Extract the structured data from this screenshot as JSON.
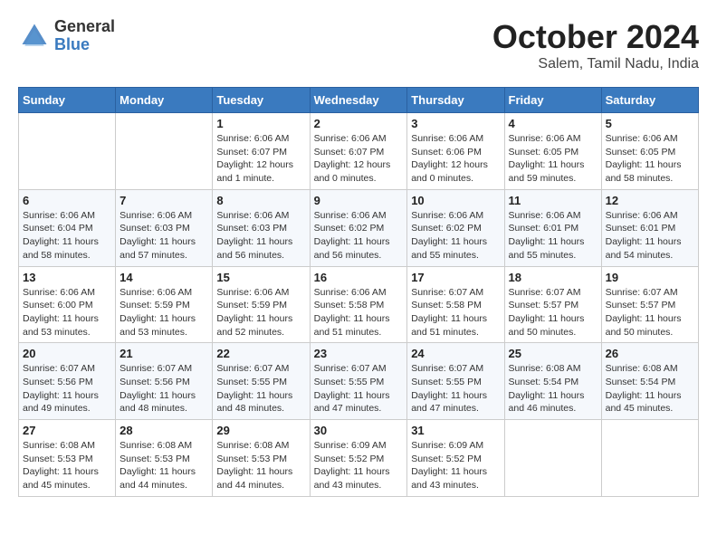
{
  "logo": {
    "general": "General",
    "blue": "Blue"
  },
  "title": "October 2024",
  "location": "Salem, Tamil Nadu, India",
  "days_header": [
    "Sunday",
    "Monday",
    "Tuesday",
    "Wednesday",
    "Thursday",
    "Friday",
    "Saturday"
  ],
  "weeks": [
    [
      {
        "day": "",
        "info": ""
      },
      {
        "day": "",
        "info": ""
      },
      {
        "day": "1",
        "info": "Sunrise: 6:06 AM\nSunset: 6:07 PM\nDaylight: 12 hours\nand 1 minute."
      },
      {
        "day": "2",
        "info": "Sunrise: 6:06 AM\nSunset: 6:07 PM\nDaylight: 12 hours\nand 0 minutes."
      },
      {
        "day": "3",
        "info": "Sunrise: 6:06 AM\nSunset: 6:06 PM\nDaylight: 12 hours\nand 0 minutes."
      },
      {
        "day": "4",
        "info": "Sunrise: 6:06 AM\nSunset: 6:05 PM\nDaylight: 11 hours\nand 59 minutes."
      },
      {
        "day": "5",
        "info": "Sunrise: 6:06 AM\nSunset: 6:05 PM\nDaylight: 11 hours\nand 58 minutes."
      }
    ],
    [
      {
        "day": "6",
        "info": "Sunrise: 6:06 AM\nSunset: 6:04 PM\nDaylight: 11 hours\nand 58 minutes."
      },
      {
        "day": "7",
        "info": "Sunrise: 6:06 AM\nSunset: 6:03 PM\nDaylight: 11 hours\nand 57 minutes."
      },
      {
        "day": "8",
        "info": "Sunrise: 6:06 AM\nSunset: 6:03 PM\nDaylight: 11 hours\nand 56 minutes."
      },
      {
        "day": "9",
        "info": "Sunrise: 6:06 AM\nSunset: 6:02 PM\nDaylight: 11 hours\nand 56 minutes."
      },
      {
        "day": "10",
        "info": "Sunrise: 6:06 AM\nSunset: 6:02 PM\nDaylight: 11 hours\nand 55 minutes."
      },
      {
        "day": "11",
        "info": "Sunrise: 6:06 AM\nSunset: 6:01 PM\nDaylight: 11 hours\nand 55 minutes."
      },
      {
        "day": "12",
        "info": "Sunrise: 6:06 AM\nSunset: 6:01 PM\nDaylight: 11 hours\nand 54 minutes."
      }
    ],
    [
      {
        "day": "13",
        "info": "Sunrise: 6:06 AM\nSunset: 6:00 PM\nDaylight: 11 hours\nand 53 minutes."
      },
      {
        "day": "14",
        "info": "Sunrise: 6:06 AM\nSunset: 5:59 PM\nDaylight: 11 hours\nand 53 minutes."
      },
      {
        "day": "15",
        "info": "Sunrise: 6:06 AM\nSunset: 5:59 PM\nDaylight: 11 hours\nand 52 minutes."
      },
      {
        "day": "16",
        "info": "Sunrise: 6:06 AM\nSunset: 5:58 PM\nDaylight: 11 hours\nand 51 minutes."
      },
      {
        "day": "17",
        "info": "Sunrise: 6:07 AM\nSunset: 5:58 PM\nDaylight: 11 hours\nand 51 minutes."
      },
      {
        "day": "18",
        "info": "Sunrise: 6:07 AM\nSunset: 5:57 PM\nDaylight: 11 hours\nand 50 minutes."
      },
      {
        "day": "19",
        "info": "Sunrise: 6:07 AM\nSunset: 5:57 PM\nDaylight: 11 hours\nand 50 minutes."
      }
    ],
    [
      {
        "day": "20",
        "info": "Sunrise: 6:07 AM\nSunset: 5:56 PM\nDaylight: 11 hours\nand 49 minutes."
      },
      {
        "day": "21",
        "info": "Sunrise: 6:07 AM\nSunset: 5:56 PM\nDaylight: 11 hours\nand 48 minutes."
      },
      {
        "day": "22",
        "info": "Sunrise: 6:07 AM\nSunset: 5:55 PM\nDaylight: 11 hours\nand 48 minutes."
      },
      {
        "day": "23",
        "info": "Sunrise: 6:07 AM\nSunset: 5:55 PM\nDaylight: 11 hours\nand 47 minutes."
      },
      {
        "day": "24",
        "info": "Sunrise: 6:07 AM\nSunset: 5:55 PM\nDaylight: 11 hours\nand 47 minutes."
      },
      {
        "day": "25",
        "info": "Sunrise: 6:08 AM\nSunset: 5:54 PM\nDaylight: 11 hours\nand 46 minutes."
      },
      {
        "day": "26",
        "info": "Sunrise: 6:08 AM\nSunset: 5:54 PM\nDaylight: 11 hours\nand 45 minutes."
      }
    ],
    [
      {
        "day": "27",
        "info": "Sunrise: 6:08 AM\nSunset: 5:53 PM\nDaylight: 11 hours\nand 45 minutes."
      },
      {
        "day": "28",
        "info": "Sunrise: 6:08 AM\nSunset: 5:53 PM\nDaylight: 11 hours\nand 44 minutes."
      },
      {
        "day": "29",
        "info": "Sunrise: 6:08 AM\nSunset: 5:53 PM\nDaylight: 11 hours\nand 44 minutes."
      },
      {
        "day": "30",
        "info": "Sunrise: 6:09 AM\nSunset: 5:52 PM\nDaylight: 11 hours\nand 43 minutes."
      },
      {
        "day": "31",
        "info": "Sunrise: 6:09 AM\nSunset: 5:52 PM\nDaylight: 11 hours\nand 43 minutes."
      },
      {
        "day": "",
        "info": ""
      },
      {
        "day": "",
        "info": ""
      }
    ]
  ]
}
